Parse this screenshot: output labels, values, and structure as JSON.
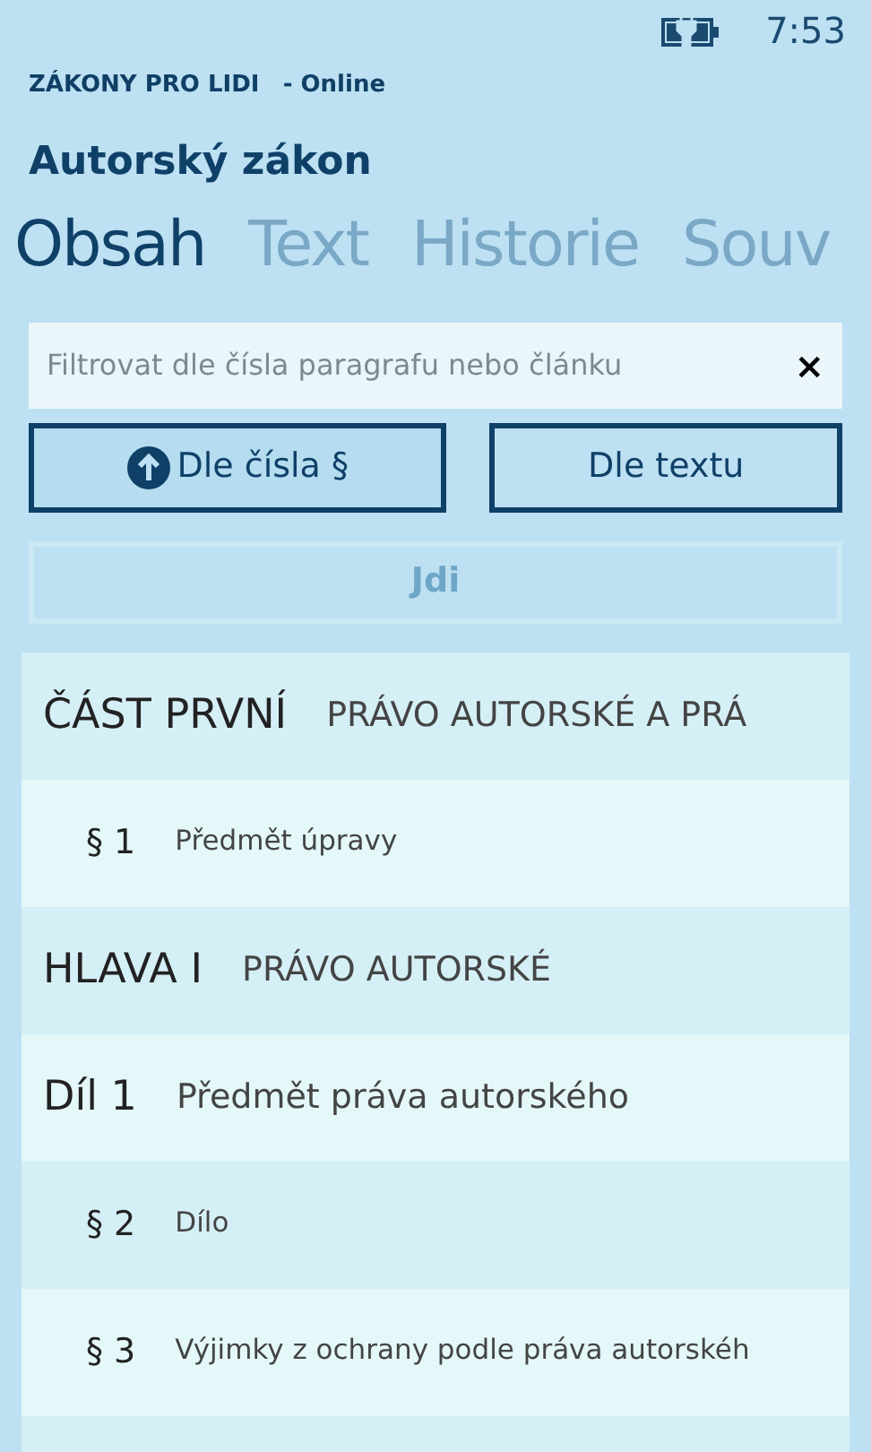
{
  "status_bar": {
    "time": "7:53"
  },
  "app": {
    "title": "ZÁKONY PRO LIDI",
    "mode": "- Online"
  },
  "page_title": "Autorský zákon",
  "tabs": [
    {
      "label": "Obsah",
      "selected": true
    },
    {
      "label": "Text",
      "selected": false
    },
    {
      "label": "Historie",
      "selected": false
    },
    {
      "label": "Souv",
      "selected": false
    }
  ],
  "filter": {
    "placeholder": "Filtrovat dle čísla paragrafu nebo článku",
    "clear": "×"
  },
  "sort_buttons": [
    {
      "label": "Dle čísla §",
      "selected": true
    },
    {
      "label": "Dle textu",
      "selected": false
    }
  ],
  "go_button": {
    "label": "Jdi",
    "disabled": true
  },
  "contents": [
    {
      "kind": "heading",
      "number": "ČÁST PRVNÍ",
      "title": "PRÁVO AUTORSKÉ A PRÁ"
    },
    {
      "kind": "paragraph",
      "number": "§ 1",
      "title": "Předmět úpravy"
    },
    {
      "kind": "heading",
      "number": "HLAVA I",
      "title": "PRÁVO AUTORSKÉ"
    },
    {
      "kind": "heading",
      "number": "Díl 1",
      "title": "Předmět práva autorského"
    },
    {
      "kind": "paragraph",
      "number": "§ 2",
      "title": "Dílo"
    },
    {
      "kind": "paragraph",
      "number": "§ 3",
      "title": "Výjimky z ochrany podle práva autorskéh"
    },
    {
      "kind": "empty"
    }
  ]
}
